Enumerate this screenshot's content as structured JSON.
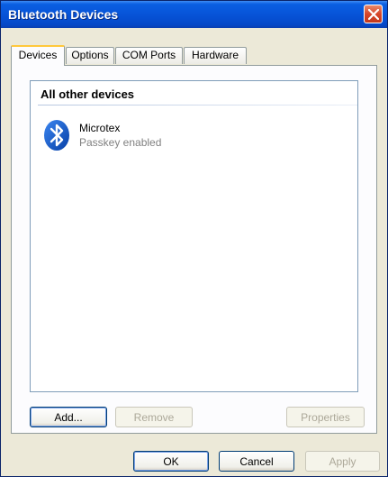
{
  "window": {
    "title": "Bluetooth Devices"
  },
  "tabs": [
    {
      "label": "Devices",
      "active": true
    },
    {
      "label": "Options",
      "active": false
    },
    {
      "label": "COM Ports",
      "active": false
    },
    {
      "label": "Hardware",
      "active": false
    }
  ],
  "device_list": {
    "group_header": "All other devices",
    "items": [
      {
        "name": "Microtex",
        "status": "Passkey enabled",
        "icon": "bluetooth-icon"
      }
    ]
  },
  "panel_buttons": {
    "add": "Add...",
    "remove": "Remove",
    "properties": "Properties"
  },
  "dialog_buttons": {
    "ok": "OK",
    "cancel": "Cancel",
    "apply": "Apply"
  },
  "colors": {
    "titlebar": "#0754d8",
    "bluetooth": "#0a55c8",
    "dialog_face": "#ece9d8"
  }
}
